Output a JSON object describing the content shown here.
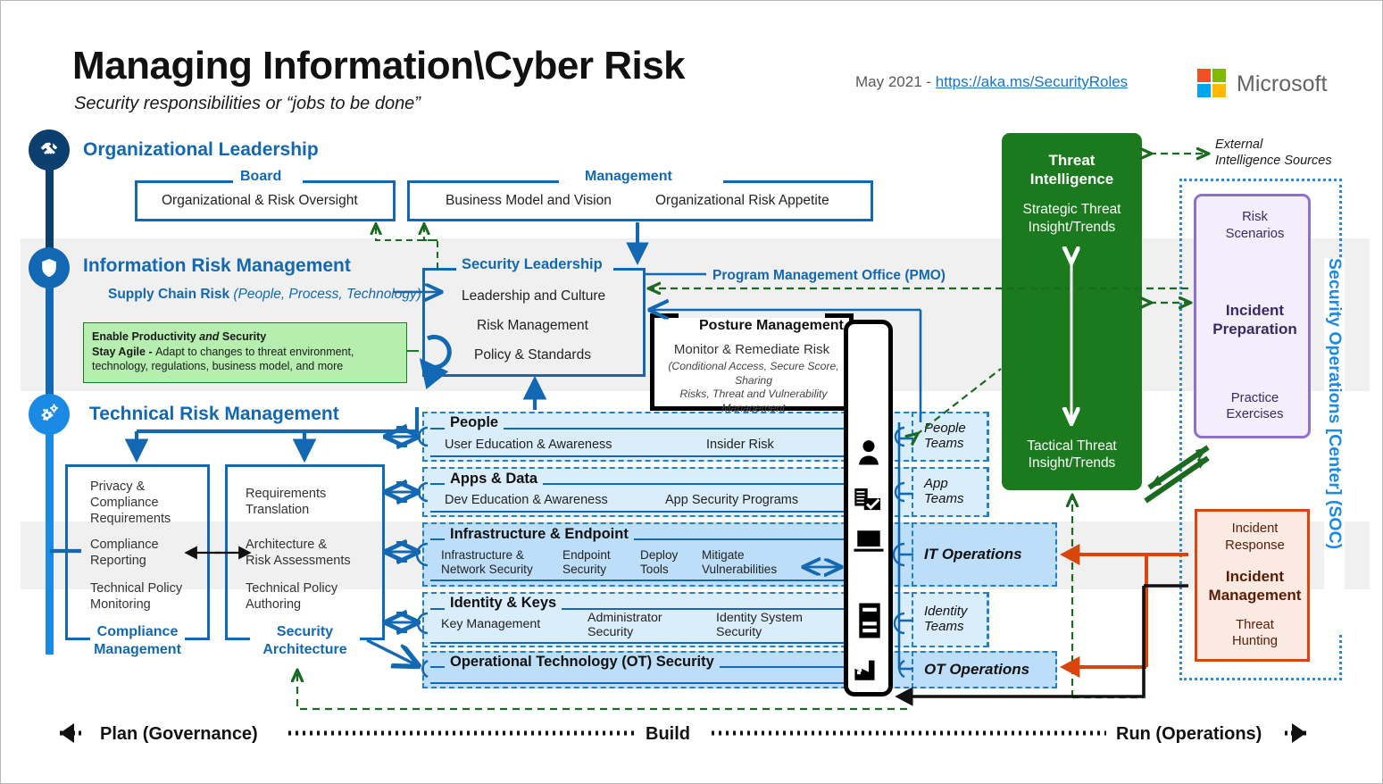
{
  "header": {
    "title": "Managing Information\\Cyber Risk",
    "subtitle": "Security responsibilities or “jobs to be done”",
    "date_prefix": "May 2021 - ",
    "link": "https://aka.ms/SecurityRoles",
    "brand": "Microsoft"
  },
  "zones": {
    "organizational_leadership": "Organizational Leadership",
    "information_risk_management": "Information Risk Management",
    "technical_risk_management": "Technical Risk Management"
  },
  "board": {
    "title": "Board",
    "items": [
      "Organizational & Risk Oversight"
    ]
  },
  "management": {
    "title": "Management",
    "items": [
      "Business Model and Vision",
      "Organizational Risk Appetite"
    ]
  },
  "supply_chain": {
    "label": "Supply Chain Risk ",
    "detail": "(People, Process, Technology)"
  },
  "green_note": {
    "line1_bold": "Enable Productivity ",
    "line1_italic": "and",
    "line1_tail": " Security",
    "line2_bold": "Stay Agile - ",
    "line2_tail": "Adapt to changes to threat environment,",
    "line3": "technology, regulations, business model, and more"
  },
  "security_leadership": {
    "title": "Security Leadership",
    "items": [
      "Leadership and Culture",
      "Risk Management",
      "Policy & Standards"
    ]
  },
  "pmo": {
    "label": "Program Management Office (PMO)"
  },
  "posture": {
    "title": "Posture Management",
    "subtitle": "Monitor & Remediate Risk",
    "detail": "(Conditional Access, Secure Score, Sharing\nRisks, Threat and Vulnerability Management\n(TVM) User & Asset Scores, etc.)"
  },
  "compliance": {
    "items": [
      "Privacy &\nCompliance\nRequirements",
      "Compliance\nReporting",
      "Technical Policy\nMonitoring"
    ],
    "title": "Compliance\nManagement"
  },
  "architecture": {
    "items": [
      "Requirements\nTranslation",
      "Architecture &\nRisk Assessments",
      "Technical Policy\nAuthoring"
    ],
    "title": "Security\nArchitecture"
  },
  "layers": [
    {
      "title": "People",
      "icon": "person-icon",
      "items": [
        "User Education & Awareness",
        "Insider Risk"
      ],
      "team": "People\nTeams"
    },
    {
      "title": "Apps & Data",
      "icon": "document-check-icon",
      "items": [
        "Dev Education & Awareness",
        "App Security Programs"
      ],
      "team": "App\nTeams"
    },
    {
      "title": "Infrastructure & Endpoint",
      "icon": "laptop-icon",
      "items": [
        "Infrastructure &\nNetwork Security",
        "Endpoint\nSecurity",
        "Deploy\nTools",
        "Mitigate\nVulnerabilities"
      ],
      "team": "IT Operations"
    },
    {
      "title": "Identity & Keys",
      "icon": "server-icon",
      "items": [
        "Key Management",
        "Administrator\nSecurity",
        "Identity System\nSecurity"
      ],
      "team": "Identity\nTeams"
    },
    {
      "title": "Operational Technology (OT) Security",
      "icon": "factory-icon",
      "items": [],
      "team": "OT Operations"
    }
  ],
  "threat_intelligence": {
    "title": "Threat\nIntelligence",
    "top": "Strategic Threat\nInsight/Trends",
    "bottom": "Tactical Threat\nInsight/Trends"
  },
  "external_sources": "External\nIntelligence Sources",
  "soc": {
    "label": "Security Operations [Center] (SOC)",
    "incident_preparation": {
      "top": "Risk\nScenarios",
      "title": "Incident\nPreparation",
      "bottom": "Practice\nExercises"
    },
    "incident_management": {
      "top": "Incident\nResponse",
      "title": "Incident\nManagement",
      "bottom": "Threat\nHunting"
    }
  },
  "lifecycle": {
    "plan": "Plan (Governance)",
    "build": "Build",
    "run": "Run (Operations)"
  },
  "colors": {
    "brand_blue": "#1268b3",
    "layer_blue": "#1e7fd4",
    "threat_green": "#1a7a1d",
    "incident_orange": "#d9460d",
    "prep_purple": "#8f6fd4",
    "note_green": "#b6eeb0"
  }
}
